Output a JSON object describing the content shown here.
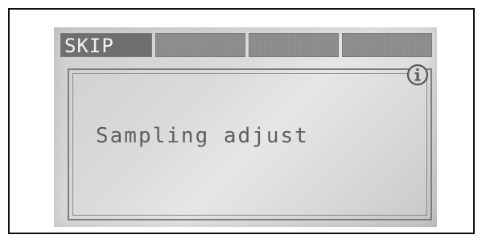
{
  "softkeys": [
    {
      "label": "SKIP",
      "active": true
    },
    {
      "label": "",
      "active": false
    },
    {
      "label": "",
      "active": false
    },
    {
      "label": "",
      "active": false
    }
  ],
  "screen": {
    "message": "Sampling adjust",
    "icon": "info-icon"
  },
  "colors": {
    "lcd_background": "#dadada",
    "softkey_fill": "#8d8d8d",
    "text": "#5e5e5e"
  }
}
